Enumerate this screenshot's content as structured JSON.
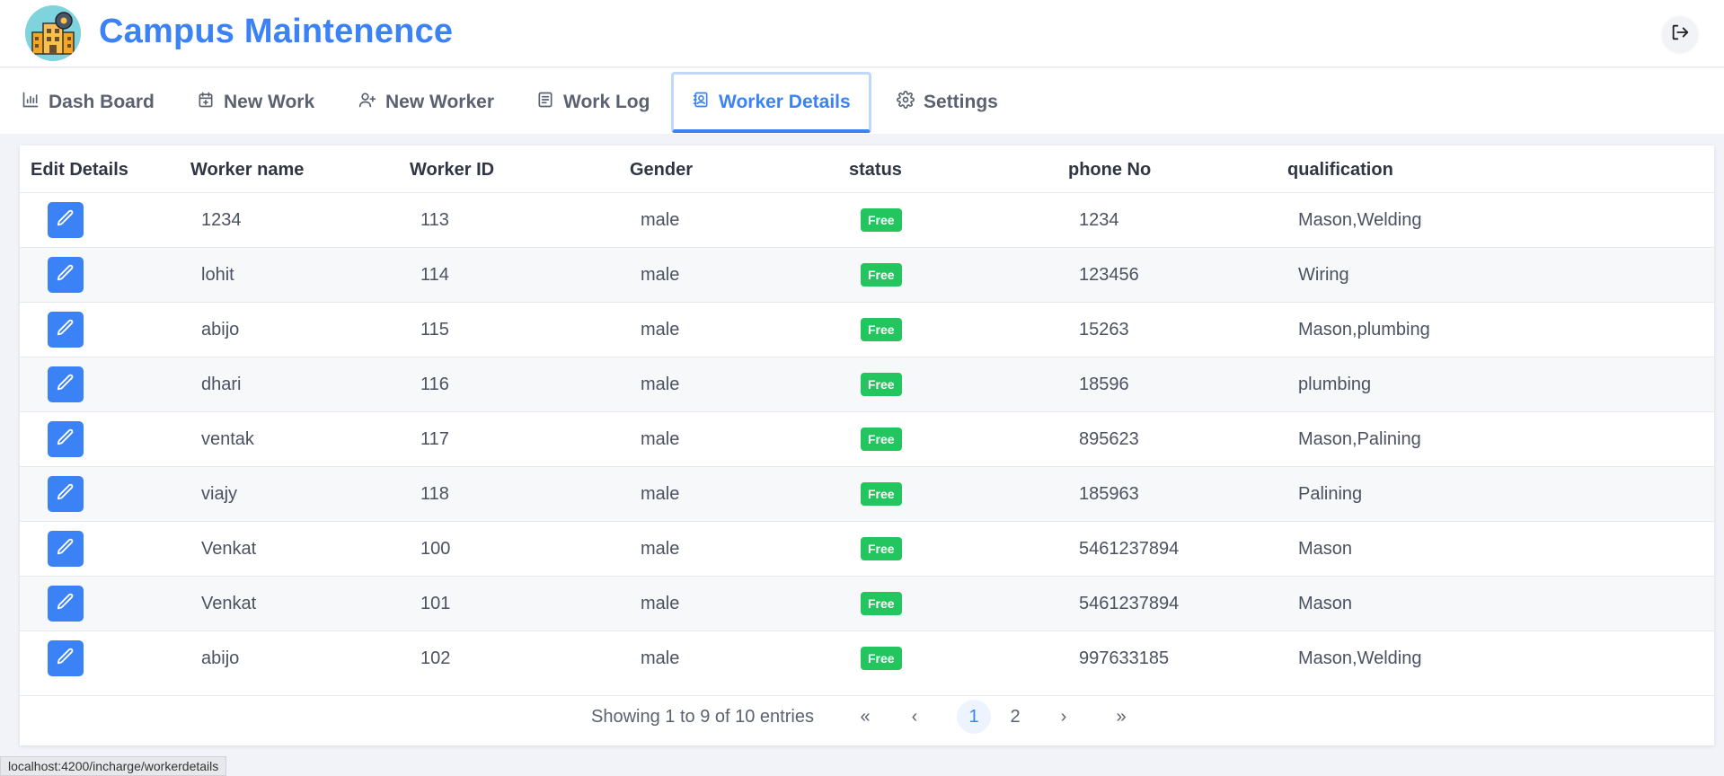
{
  "app": {
    "title": "Campus Maintenence"
  },
  "icons": {
    "logo": "campus-building-logo",
    "logout": "logout-icon",
    "edit": "pencil-icon"
  },
  "colors": {
    "accent": "#3b82f6",
    "status_free": "#22c55e"
  },
  "nav": {
    "tabs": [
      {
        "label": "Dash Board",
        "icon": "bar-chart-icon",
        "active": false
      },
      {
        "label": "New Work",
        "icon": "calendar-plus-icon",
        "active": false
      },
      {
        "label": "New Worker",
        "icon": "user-plus-icon",
        "active": false
      },
      {
        "label": "Work Log",
        "icon": "document-icon",
        "active": false
      },
      {
        "label": "Worker Details",
        "icon": "contact-card-icon",
        "active": true
      },
      {
        "label": "Settings",
        "icon": "gear-icon",
        "active": false
      }
    ]
  },
  "table": {
    "headers": [
      "Edit Details",
      "Worker name",
      "Worker ID",
      "Gender",
      "status",
      "phone No",
      "qualification"
    ],
    "rows": [
      {
        "name": "1234",
        "id": "113",
        "gender": "male",
        "status": "Free",
        "phone": "1234",
        "qualification": "Mason,Welding"
      },
      {
        "name": "lohit",
        "id": "114",
        "gender": "male",
        "status": "Free",
        "phone": "123456",
        "qualification": "Wiring"
      },
      {
        "name": "abijo",
        "id": "115",
        "gender": "male",
        "status": "Free",
        "phone": "15263",
        "qualification": "Mason,plumbing"
      },
      {
        "name": "dhari",
        "id": "116",
        "gender": "male",
        "status": "Free",
        "phone": "18596",
        "qualification": "plumbing"
      },
      {
        "name": "ventak",
        "id": "117",
        "gender": "male",
        "status": "Free",
        "phone": "895623",
        "qualification": "Mason,Palining"
      },
      {
        "name": "viajy",
        "id": "118",
        "gender": "male",
        "status": "Free",
        "phone": "185963",
        "qualification": "Palining"
      },
      {
        "name": "Venkat",
        "id": "100",
        "gender": "male",
        "status": "Free",
        "phone": "5461237894",
        "qualification": "Mason"
      },
      {
        "name": "Venkat",
        "id": "101",
        "gender": "male",
        "status": "Free",
        "phone": "5461237894",
        "qualification": "Mason"
      },
      {
        "name": "abijo",
        "id": "102",
        "gender": "male",
        "status": "Free",
        "phone": "997633185",
        "qualification": "Mason,Welding"
      }
    ]
  },
  "pagination": {
    "report": "Showing 1 to 9 of 10 entries",
    "first": "«",
    "prev": "‹",
    "pages": [
      "1",
      "2"
    ],
    "current_page": "1",
    "next": "›",
    "last": "»"
  },
  "status_bar": {
    "url": "localhost:4200/incharge/workerdetails"
  }
}
